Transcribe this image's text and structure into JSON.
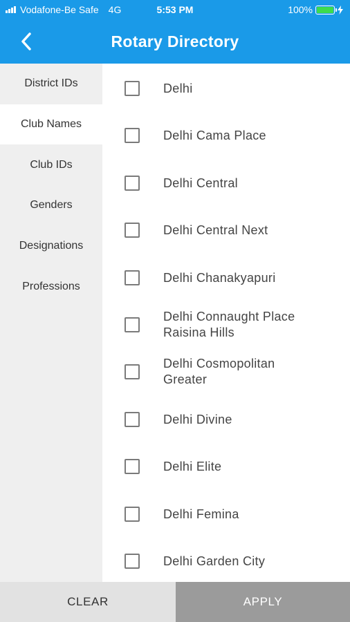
{
  "status_bar": {
    "carrier": "Vodafone-Be Safe",
    "network": "4G",
    "time": "5:53 PM",
    "battery": "100%",
    "battery_level": 1.0,
    "battery_color": "#3ddc4c"
  },
  "header": {
    "title": "Rotary Directory",
    "back_icon": "chevron-left-icon",
    "color": "#1a9ae8"
  },
  "sidebar": {
    "items": [
      {
        "label": "District IDs",
        "active": false
      },
      {
        "label": "Club Names",
        "active": true
      },
      {
        "label": "Club IDs",
        "active": false
      },
      {
        "label": "Genders",
        "active": false
      },
      {
        "label": "Designations",
        "active": false
      },
      {
        "label": "Professions",
        "active": false
      }
    ]
  },
  "clubs": {
    "items": [
      {
        "label": "Delhi",
        "checked": false
      },
      {
        "label": "Delhi Cama Place",
        "checked": false
      },
      {
        "label": "Delhi Central",
        "checked": false
      },
      {
        "label": "Delhi Central Next",
        "checked": false
      },
      {
        "label": "Delhi Chanakyapuri",
        "checked": false
      },
      {
        "label": "Delhi Connaught Place\nRaisina Hills",
        "checked": false
      },
      {
        "label": "Delhi Cosmopolitan\nGreater",
        "checked": false
      },
      {
        "label": "Delhi Divine",
        "checked": false
      },
      {
        "label": "Delhi Elite",
        "checked": false
      },
      {
        "label": "Delhi Femina",
        "checked": false
      },
      {
        "label": "Delhi Garden City",
        "checked": false
      }
    ]
  },
  "footer": {
    "clear_label": "CLEAR",
    "apply_label": "APPLY"
  }
}
